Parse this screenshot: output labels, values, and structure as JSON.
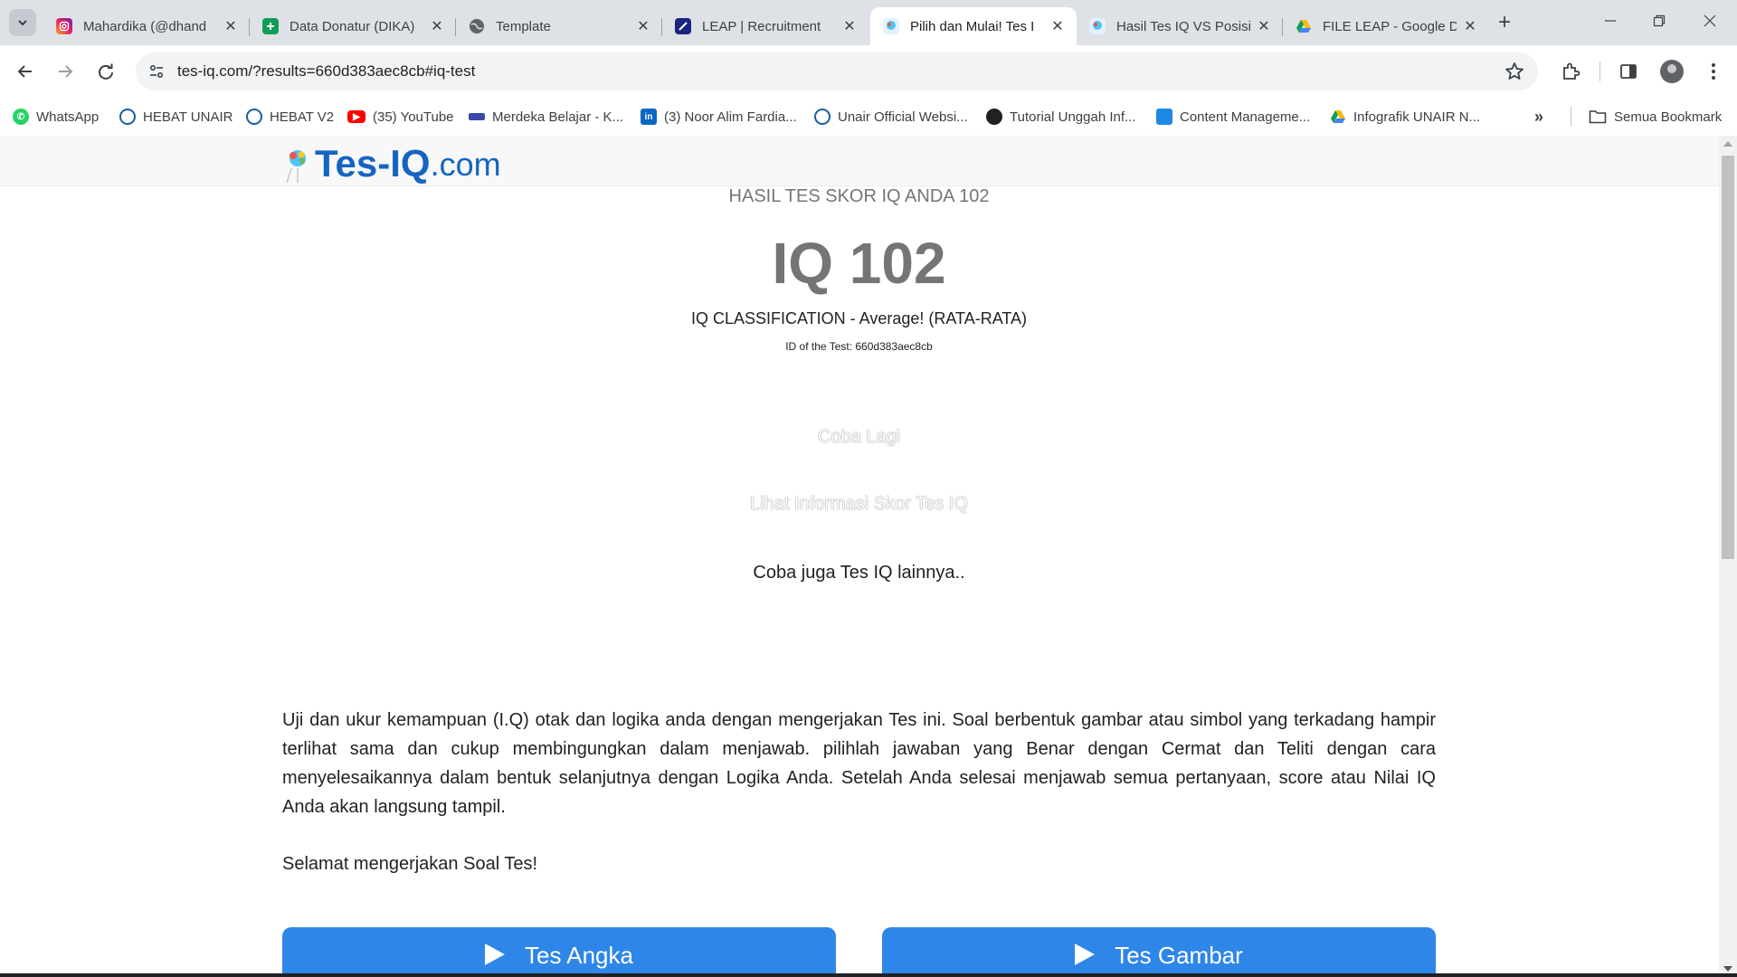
{
  "tabs": [
    {
      "title": "Mahardika (@dhand",
      "icon": "instagram-icon"
    },
    {
      "title": "Data Donatur (DIKA)",
      "icon": "google-sheets-icon"
    },
    {
      "title": "Template",
      "icon": "globe-icon"
    },
    {
      "title": "LEAP | Recruitment",
      "icon": "leap-icon"
    },
    {
      "title": "Pilih dan Mulai! Tes I",
      "icon": "tes-iq-icon",
      "active": true
    },
    {
      "title": "Hasil Tes IQ VS Posisi",
      "icon": "tes-iq-icon"
    },
    {
      "title": "FILE LEAP - Google D",
      "icon": "google-drive-icon"
    }
  ],
  "address_bar": {
    "url": "tes-iq.com/?results=660d383aec8cb#iq-test"
  },
  "bookmarks": [
    {
      "label": "WhatsApp",
      "icon": "whatsapp-icon",
      "color": "#25d366"
    },
    {
      "label": "HEBAT UNAIR",
      "icon": "unair-icon",
      "color": "#1a5fa3"
    },
    {
      "label": "HEBAT V2",
      "icon": "unair-icon",
      "color": "#1a5fa3"
    },
    {
      "label": "(35) YouTube",
      "icon": "youtube-icon",
      "color": "#ff0000"
    },
    {
      "label": "Merdeka Belajar - K...",
      "icon": "merdeka-belajar-icon",
      "color": "#3949ab"
    },
    {
      "label": "(3) Noor Alim Fardia...",
      "icon": "linkedin-icon",
      "color": "#0a66c2"
    },
    {
      "label": "Unair Official Websi...",
      "icon": "unair-icon",
      "color": "#1a5fa3"
    },
    {
      "label": "Tutorial Unggah Inf...",
      "icon": "globe-dark-icon",
      "color": "#202124"
    },
    {
      "label": "Content Manageme...",
      "icon": "cms-icon",
      "color": "#1e88e5"
    },
    {
      "label": "Infografik UNAIR N...",
      "icon": "google-drive-icon",
      "color": "#fbbc04"
    }
  ],
  "all_bookmarks_label": "Semua Bookmark",
  "site": {
    "logo_main": "Tes-IQ",
    "logo_domain": ".com",
    "accent_color": "#1565c0"
  },
  "result": {
    "subtitle": "HASIL TES SKOR IQ ANDA 102",
    "score": "IQ 102",
    "classification": "IQ CLASSIFICATION - Average! (RATA-RATA)",
    "test_id": "ID of the Test: 660d383aec8cb",
    "retry_label": "Coba Lagi",
    "info_label": "Lihat Informasi Skor Tes IQ",
    "more_label": "Coba juga Tes IQ lainnya.."
  },
  "description": "Uji dan ukur kemampuan (I.Q) otak dan logika anda dengan mengerjakan Tes ini. Soal berbentuk gambar atau simbol yang terkadang hampir terlihat sama dan cukup membingungkan dalam menjawab. pilihlah jawaban yang Benar dengan Cermat dan Teliti dengan cara menyelesaikannya dalam bentuk selanjutnya dengan Logika Anda. Setelah Anda selesai menjawab semua pertanyaan, score atau Nilai IQ Anda akan langsung tampil.",
  "greeting": "Selamat mengerjakan Soal Tes!",
  "test_buttons": [
    {
      "label": "Tes Angka",
      "color": "#2e86e8"
    },
    {
      "label": "Tes Gambar",
      "color": "#2e86e8"
    }
  ]
}
